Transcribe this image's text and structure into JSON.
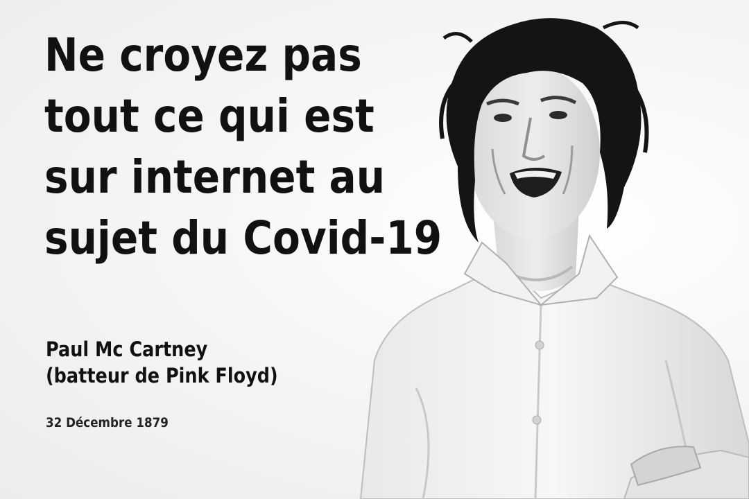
{
  "quote": {
    "lines": [
      "Ne croyez pas",
      "tout ce qui est",
      "sur internet au",
      "sujet du Covid-19"
    ]
  },
  "attribution": {
    "name": "Paul Mc Cartney",
    "role": "(batteur de Pink Floyd)",
    "date": "32 Décembre 1879"
  },
  "photo": {
    "subject": "portrait-photo",
    "palette": [
      "#111111",
      "#2a2a2a",
      "#dcdcdc",
      "#f2f2f2"
    ]
  }
}
